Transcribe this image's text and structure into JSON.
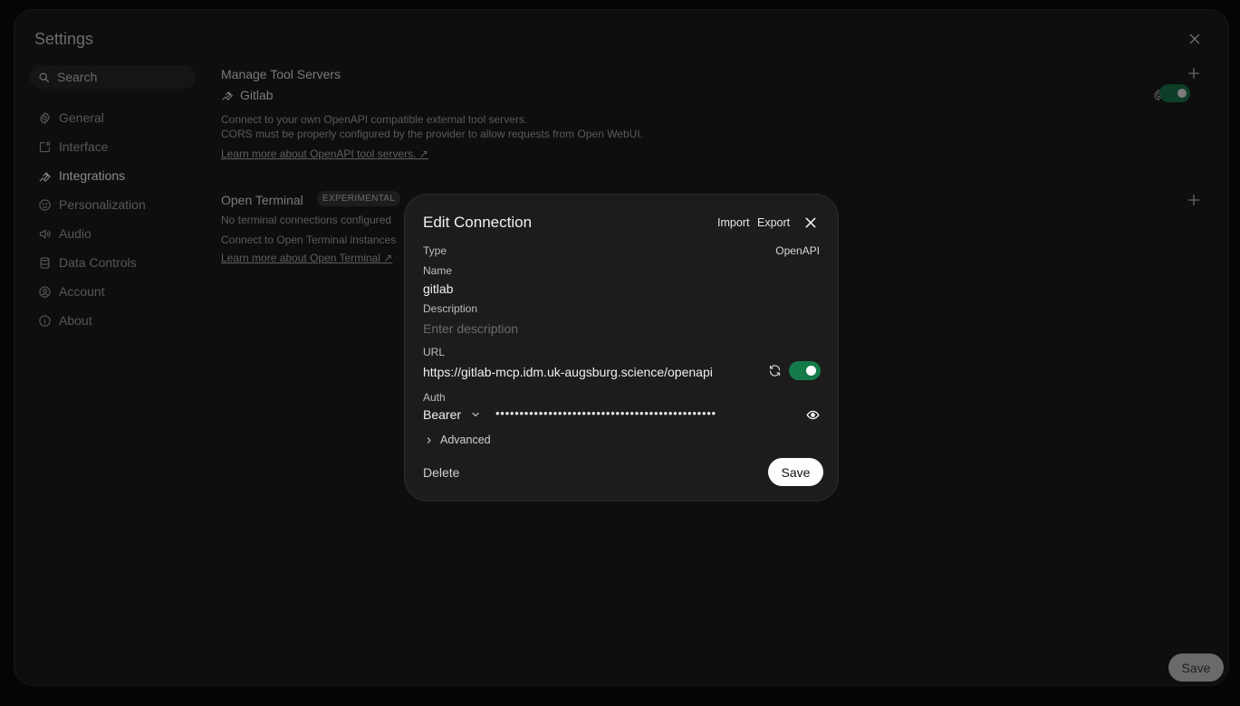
{
  "settings": {
    "title": "Settings",
    "search_placeholder": "Search",
    "nav": [
      {
        "label": "General",
        "icon": "gear-icon"
      },
      {
        "label": "Interface",
        "icon": "interface-icon"
      },
      {
        "label": "Integrations",
        "icon": "wrench-icon"
      },
      {
        "label": "Personalization",
        "icon": "smiley-icon"
      },
      {
        "label": "Audio",
        "icon": "speaker-icon"
      },
      {
        "label": "Data Controls",
        "icon": "database-icon"
      },
      {
        "label": "Account",
        "icon": "user-circle-icon"
      },
      {
        "label": "About",
        "icon": "info-icon"
      }
    ],
    "active_nav": "Integrations",
    "tool_servers": {
      "title": "Manage Tool Servers",
      "server_name": "Gitlab",
      "server_enabled": true,
      "desc_line1": "Connect to your own OpenAPI compatible external tool servers.",
      "desc_line2": "CORS must be properly configured by the provider to allow requests from Open WebUI.",
      "learn_more": "Learn more about OpenAPI tool servers. ↗"
    },
    "open_terminal": {
      "title": "Open Terminal",
      "badge": "EXPERIMENTAL",
      "empty_text": "No terminal connections configured",
      "desc": "Connect to Open Terminal instances",
      "learn_more": "Learn more about Open Terminal ↗"
    },
    "save_label": "Save"
  },
  "modal": {
    "title": "Edit Connection",
    "import_label": "Import",
    "export_label": "Export",
    "type_label": "Type",
    "type_value": "OpenAPI",
    "name_label": "Name",
    "name_value": "gitlab",
    "description_label": "Description",
    "description_placeholder": "Enter description",
    "url_label": "URL",
    "url_value": "https://gitlab-mcp.idm.uk-augsburg.science/openapi",
    "url_enabled": true,
    "auth_label": "Auth",
    "auth_type": "Bearer",
    "auth_token_masked": "••••••••••••••••••••••••••••••••••••••••••••••",
    "advanced_label": "Advanced",
    "delete_label": "Delete",
    "save_label": "Save"
  },
  "colors": {
    "toggle_on": "#157a4a",
    "modal_bg": "#1c1c1c",
    "page_bg": "#050505"
  }
}
